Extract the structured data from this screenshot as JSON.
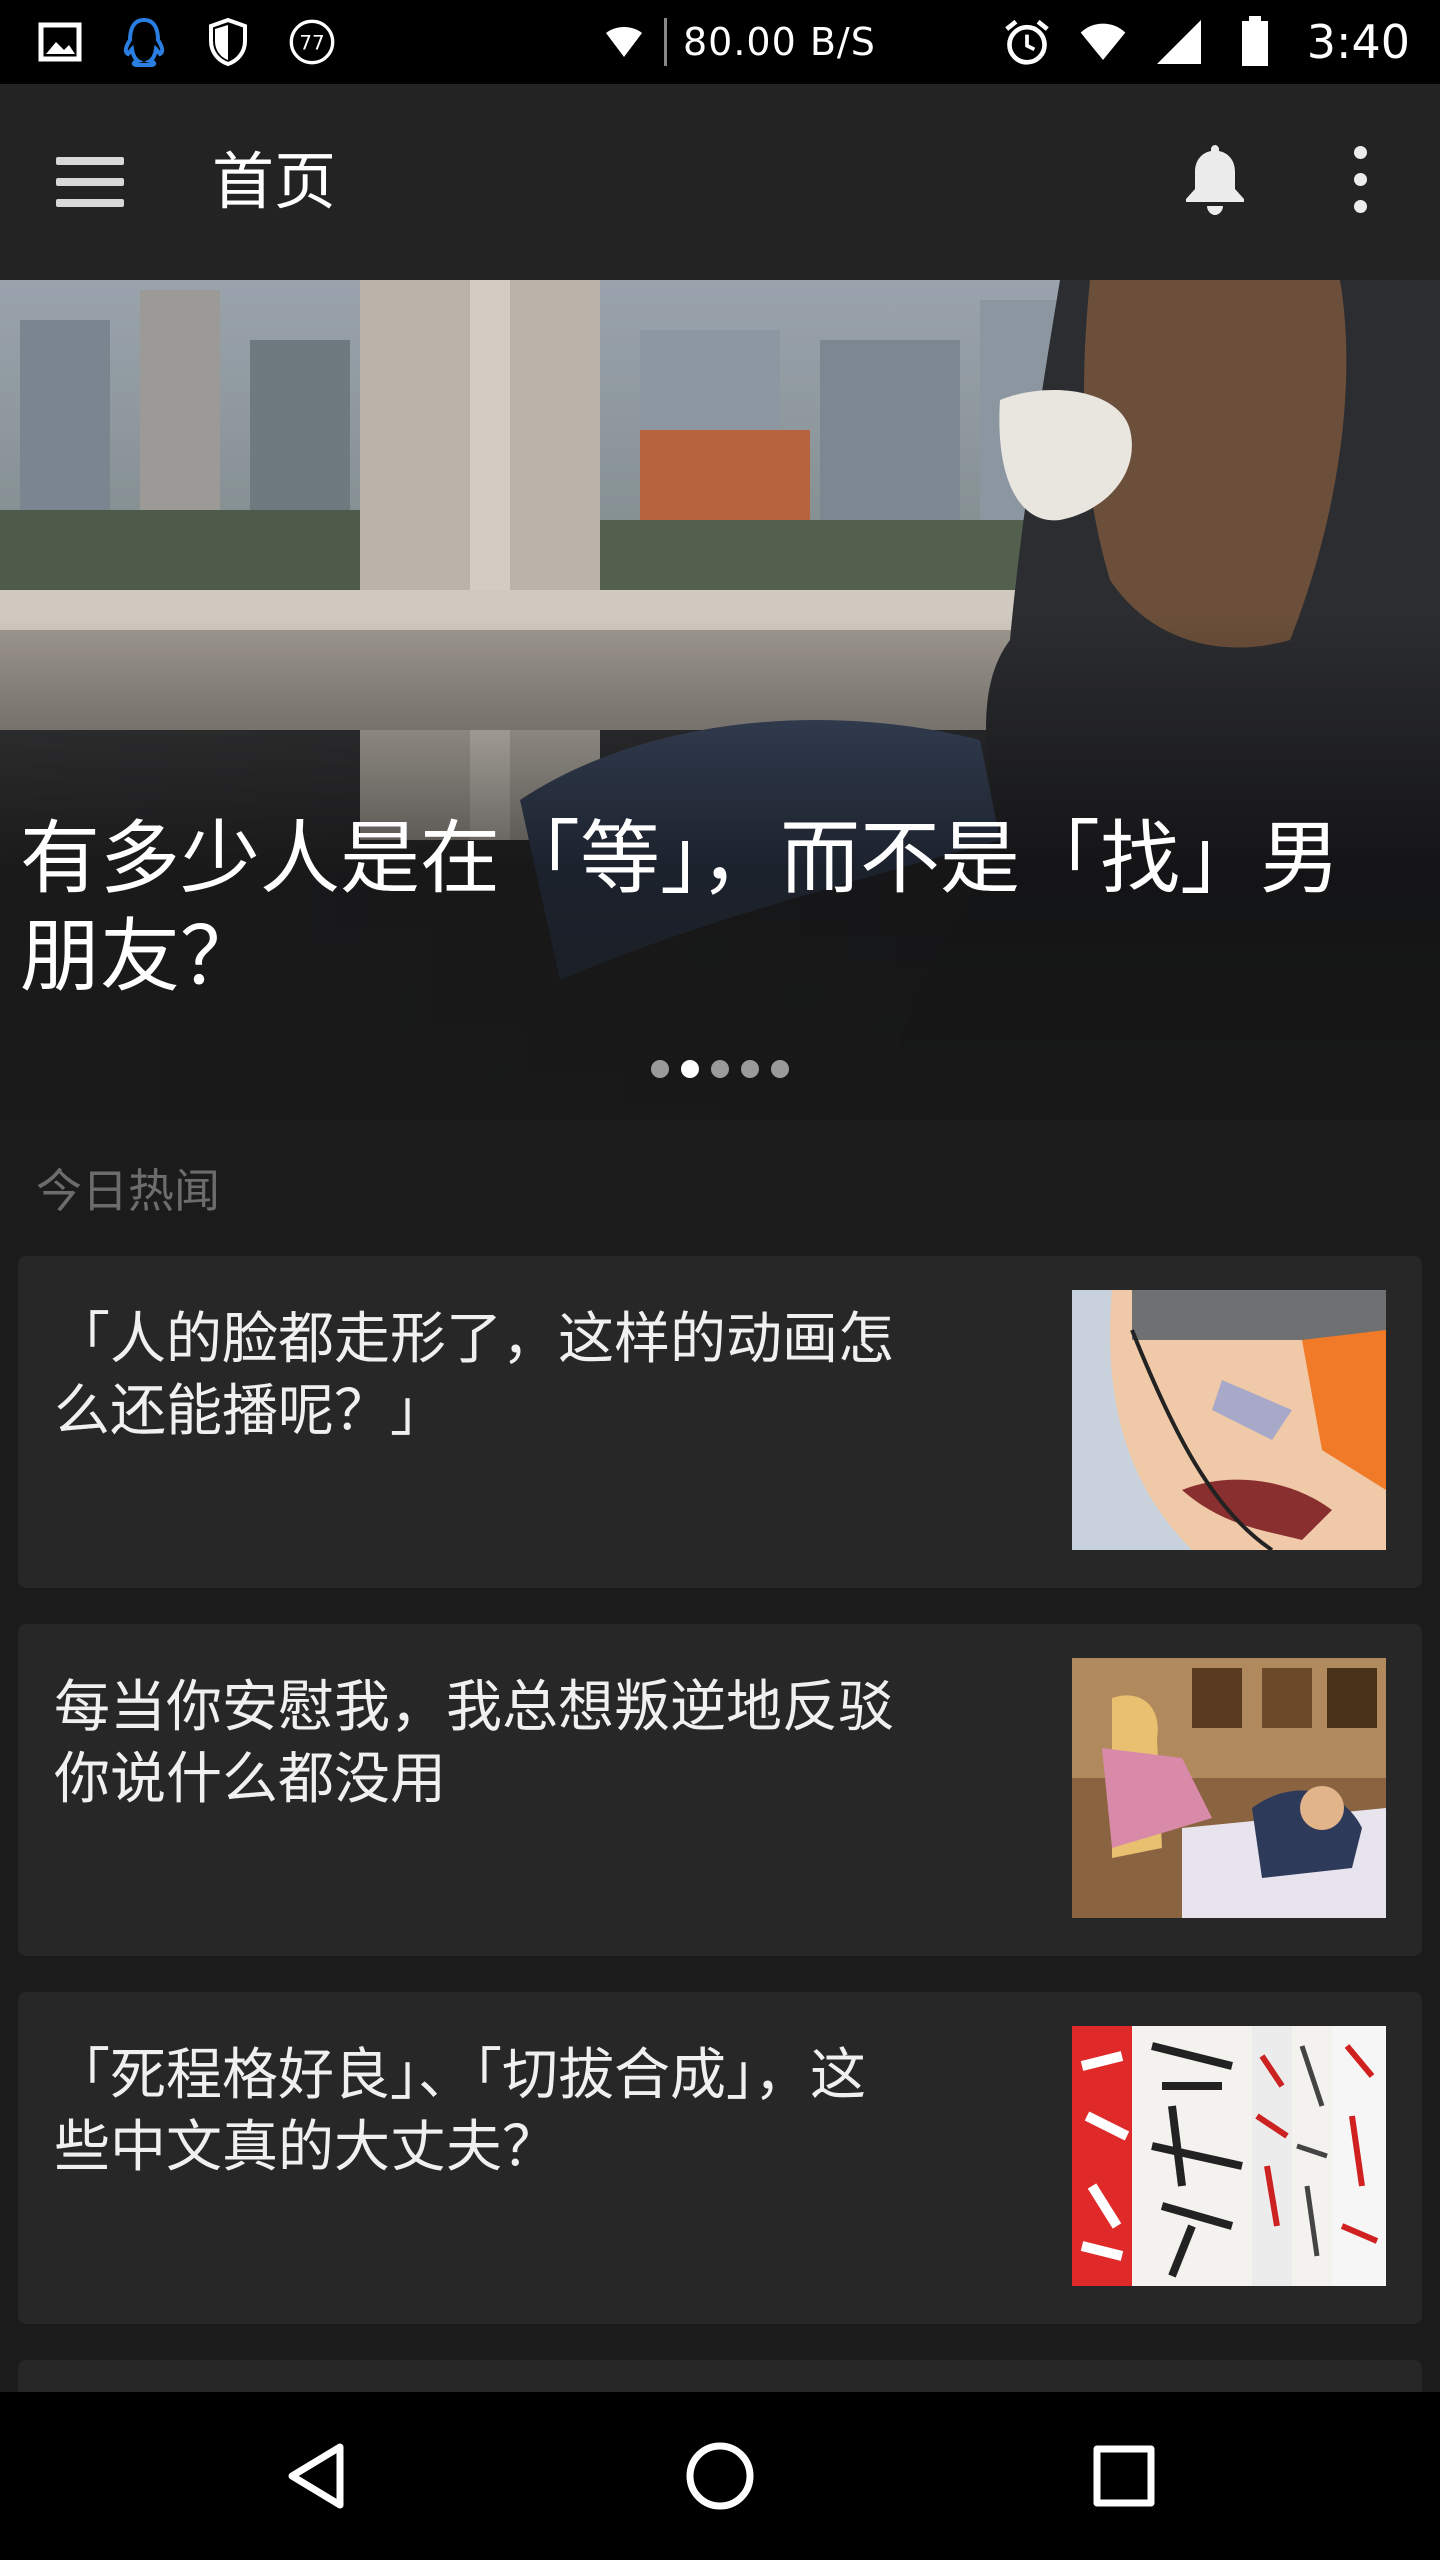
{
  "status_bar": {
    "network_speed": "80.00 B/S",
    "time": "3:40",
    "notification_count": "77",
    "icons": [
      "image-icon",
      "qq-icon",
      "shield-icon",
      "counter-badge-icon",
      "wifi-small-icon",
      "alarm-icon",
      "wifi-icon",
      "signal-icon",
      "battery-icon"
    ]
  },
  "app_bar": {
    "title": "首页",
    "menu_icon": "hamburger-menu-icon",
    "bell_icon": "bell-icon",
    "more_icon": "more-vertical-icon"
  },
  "hero": {
    "title": "有多少人是在「等」，而不是「找」男朋友？",
    "pager": {
      "count": 5,
      "active": 1
    }
  },
  "section": {
    "label": "今日热闻"
  },
  "stories": [
    {
      "title": "「人的脸都走形了，这样的动画怎么还能播呢？」"
    },
    {
      "title": "每当你安慰我，我总想叛逆地反驳你说什么都没用"
    },
    {
      "title": "「死程格好良」、「切拔合成」，这些中文真的大丈夫？"
    }
  ],
  "nav_bar": {
    "back_icon": "back-triangle-icon",
    "home_icon": "home-circle-icon",
    "recents_icon": "recents-square-icon"
  },
  "colors": {
    "background": "#1b1b1b",
    "app_bar": "#232323",
    "card": "#272727",
    "section_label": "#6c6c6c"
  }
}
